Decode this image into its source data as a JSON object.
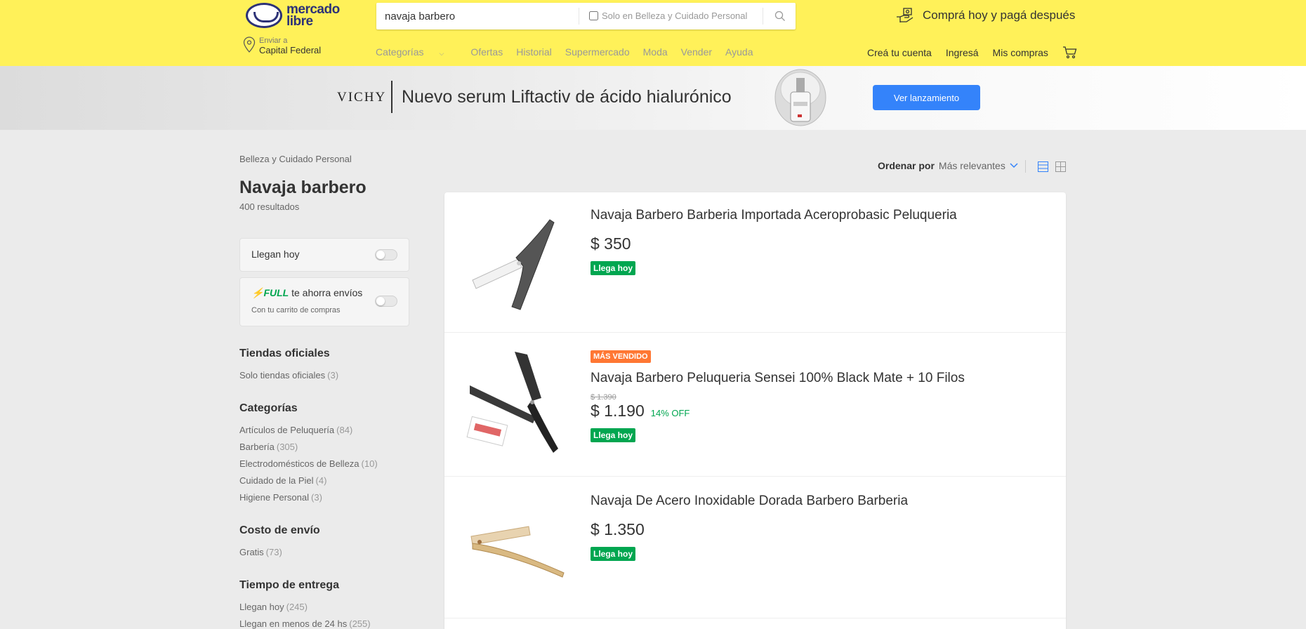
{
  "header": {
    "logo_line1": "mercado",
    "logo_line2": "libre",
    "search_value": "navaja barbero",
    "search_filter_label": "Solo en Belleza y Cuidado Personal",
    "promo_text": "Comprá hoy y pagá después",
    "location_small": "Enviar a",
    "location_main": "Capital Federal",
    "nav": [
      "Categorías",
      "Ofertas",
      "Historial",
      "Supermercado",
      "Moda",
      "Vender",
      "Ayuda"
    ],
    "user_nav": [
      "Creá tu cuenta",
      "Ingresá",
      "Mis compras"
    ],
    "brand_color": "#fff159"
  },
  "banner": {
    "brand": "VICHY",
    "text": "Nuevo serum Liftactiv de ácido hialurónico",
    "button": "Ver lanzamiento",
    "button_color": "#3483fa"
  },
  "sidebar": {
    "breadcrumb": "Belleza y Cuidado Personal",
    "title": "Navaja barbero",
    "results": "400 resultados",
    "toggle1_label": "Llegan hoy",
    "toggle2_brand": "FULL",
    "toggle2_label": "te ahorra envíos",
    "toggle2_sub": "Con tu carrito de compras",
    "groups": [
      {
        "title": "Tiendas oficiales",
        "items": [
          {
            "label": "Solo tiendas oficiales",
            "count": "(3)"
          }
        ]
      },
      {
        "title": "Categorías",
        "items": [
          {
            "label": "Artículos de Peluquería",
            "count": "(84)"
          },
          {
            "label": "Barbería",
            "count": "(305)"
          },
          {
            "label": "Electrodomésticos de Belleza",
            "count": "(10)"
          },
          {
            "label": "Cuidado de la Piel",
            "count": "(4)"
          },
          {
            "label": "Higiene Personal",
            "count": "(3)"
          }
        ]
      },
      {
        "title": "Costo de envío",
        "items": [
          {
            "label": "Gratis",
            "count": "(73)"
          }
        ]
      },
      {
        "title": "Tiempo de entrega",
        "items": [
          {
            "label": "Llegan hoy",
            "count": "(245)"
          },
          {
            "label": "Llegan en menos de 24 hs",
            "count": "(255)"
          }
        ]
      }
    ]
  },
  "sort": {
    "label": "Ordenar por",
    "value": "Más relevantes"
  },
  "items": [
    {
      "title": "Navaja Barbero Barberia Importada Aceroprobasic Peluqueria",
      "price": "$ 350",
      "shipping": "Llega hoy",
      "icon": "silver-straight-razor"
    },
    {
      "badge": "MÁS VENDIDO",
      "title": "Navaja Barbero Peluqueria Sensei 100% Black Mate + 10 Filos",
      "old_price": "$ 1.390",
      "price": "$ 1.190",
      "discount": "14% OFF",
      "shipping": "Llega hoy",
      "icon": "black-straight-razor"
    },
    {
      "title": "Navaja De Acero Inoxidable Dorada Barbero Barberia",
      "price": "$ 1.350",
      "shipping": "Llega hoy",
      "icon": "gold-straight-razor"
    }
  ]
}
